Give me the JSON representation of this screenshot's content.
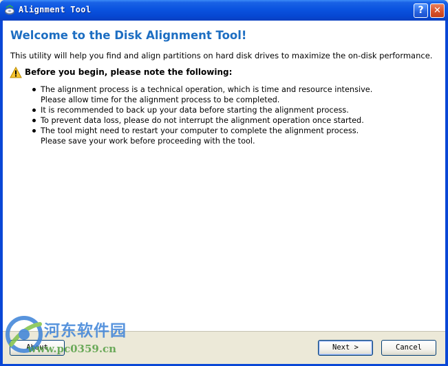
{
  "window": {
    "title": "Alignment Tool",
    "help_label": "?",
    "close_label": "✕",
    "icons": {
      "app": "disk-alignment-app-icon",
      "help": "help-icon",
      "close": "close-icon"
    }
  },
  "content": {
    "heading": "Welcome to the Disk Alignment Tool!",
    "intro": "This utility will help you find and align partitions on hard disk drives to maximize the on-disk performance.",
    "warning_icon": "warning-triangle-icon",
    "warning_heading": "Before you begin, please note the following:",
    "notes": [
      {
        "line1": "The alignment process is a technical operation, which is time and resource intensive.",
        "line2": "Please allow time for the alignment process to be completed."
      },
      {
        "line1": "It is recommended to back up your data before starting the alignment process."
      },
      {
        "line1": "To prevent data loss, please do not interrupt the alignment operation once started."
      },
      {
        "line1": "The tool might need to restart your computer to complete the alignment process.",
        "line2": "Please save your work before proceeding with the tool."
      }
    ]
  },
  "footer": {
    "about_label": "About",
    "next_label": "Next >",
    "cancel_label": "Cancel"
  },
  "watermark": {
    "text": "河东软件园",
    "url": "www.pc0359.cn"
  },
  "colors": {
    "title_bar": "#0a53df",
    "heading": "#1d6ec2",
    "footer_bg": "#ece9d8"
  }
}
